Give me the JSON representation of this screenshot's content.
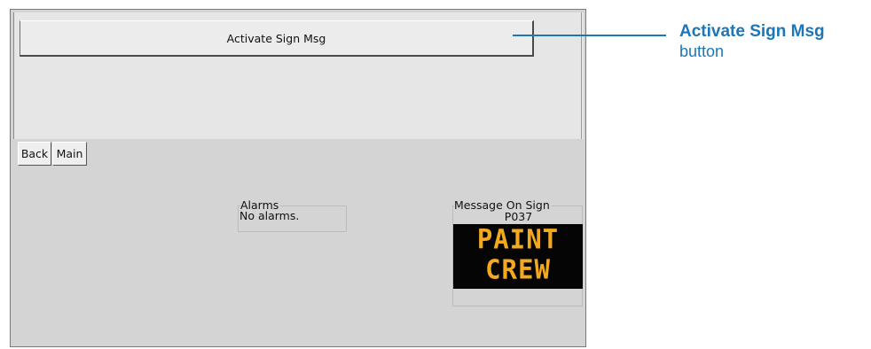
{
  "panel": {
    "activate_button_label": "Activate Sign Msg"
  },
  "nav": {
    "back_label": "Back",
    "main_label": "Main"
  },
  "alarms": {
    "legend": "Alarms",
    "status_text": "No alarms."
  },
  "sign": {
    "legend": "Message On Sign",
    "id": "P037",
    "message_lines": [
      "PAINT",
      "CREW"
    ],
    "text_color": "#f2a91e",
    "background_color": "#050505"
  },
  "callout": {
    "title": "Activate Sign Msg",
    "subtitle": "button",
    "color": "#1c76b8"
  }
}
